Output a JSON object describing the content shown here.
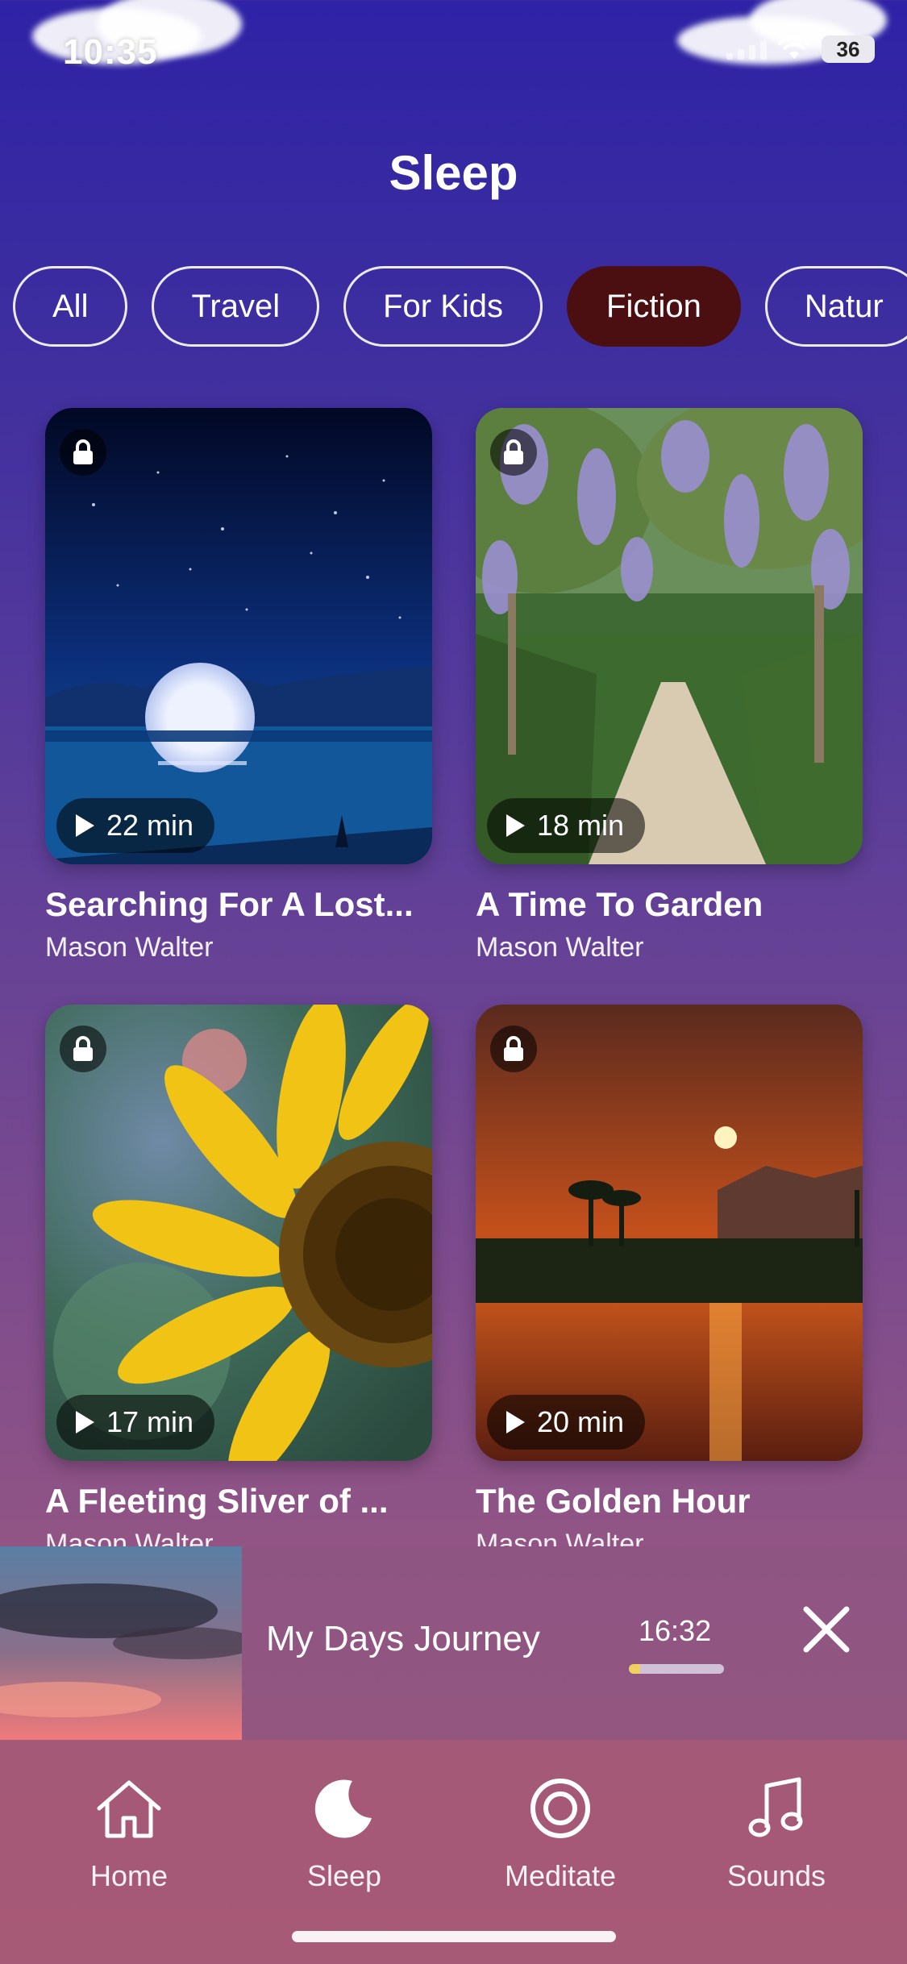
{
  "status_bar": {
    "time": "10:35",
    "battery": "36"
  },
  "page": {
    "title": "Sleep"
  },
  "categories": [
    {
      "label": "All",
      "active": false
    },
    {
      "label": "Travel",
      "active": false
    },
    {
      "label": "For Kids",
      "active": false
    },
    {
      "label": "Fiction",
      "active": true
    },
    {
      "label": "Natur",
      "active": false
    }
  ],
  "cards": [
    {
      "title": "Searching For A Lost...",
      "author": "Mason Walter",
      "duration": "22 min",
      "locked": true,
      "scene": "moon-night"
    },
    {
      "title": "A Time To Garden",
      "author": "Mason Walter",
      "duration": "18 min",
      "locked": true,
      "scene": "wisteria-path"
    },
    {
      "title": "A Fleeting Sliver of ...",
      "author": "Mason Walter",
      "duration": "17 min",
      "locked": true,
      "scene": "sunflower"
    },
    {
      "title": "The Golden Hour",
      "author": "Mason Walter",
      "duration": "20 min",
      "locked": true,
      "scene": "sunset-lake"
    }
  ],
  "player": {
    "title": "My Days Journey",
    "time": "16:32",
    "progress": 0.12
  },
  "tabs": [
    {
      "label": "Home",
      "icon": "home-icon"
    },
    {
      "label": "Sleep",
      "icon": "moon-icon",
      "active": true
    },
    {
      "label": "Meditate",
      "icon": "meditate-icon"
    },
    {
      "label": "Sounds",
      "icon": "music-note-icon"
    }
  ],
  "colors": {
    "active_chip": "#4b0f12",
    "progress_fill": "#f0d060"
  }
}
